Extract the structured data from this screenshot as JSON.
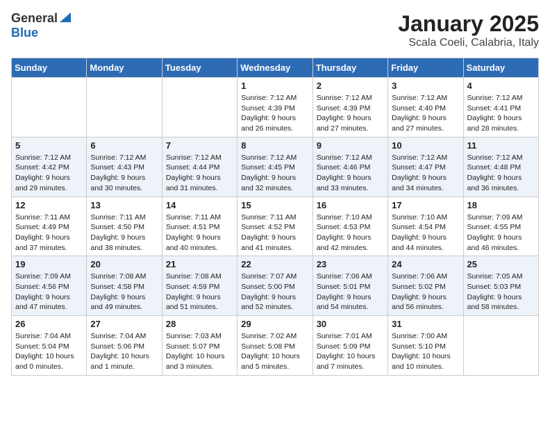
{
  "header": {
    "logo_general": "General",
    "logo_blue": "Blue",
    "month_year": "January 2025",
    "location": "Scala Coeli, Calabria, Italy"
  },
  "weekdays": [
    "Sunday",
    "Monday",
    "Tuesday",
    "Wednesday",
    "Thursday",
    "Friday",
    "Saturday"
  ],
  "weeks": [
    [
      {
        "day": "",
        "text": ""
      },
      {
        "day": "",
        "text": ""
      },
      {
        "day": "",
        "text": ""
      },
      {
        "day": "1",
        "text": "Sunrise: 7:12 AM\nSunset: 4:39 PM\nDaylight: 9 hours and 26 minutes."
      },
      {
        "day": "2",
        "text": "Sunrise: 7:12 AM\nSunset: 4:39 PM\nDaylight: 9 hours and 27 minutes."
      },
      {
        "day": "3",
        "text": "Sunrise: 7:12 AM\nSunset: 4:40 PM\nDaylight: 9 hours and 27 minutes."
      },
      {
        "day": "4",
        "text": "Sunrise: 7:12 AM\nSunset: 4:41 PM\nDaylight: 9 hours and 28 minutes."
      }
    ],
    [
      {
        "day": "5",
        "text": "Sunrise: 7:12 AM\nSunset: 4:42 PM\nDaylight: 9 hours and 29 minutes."
      },
      {
        "day": "6",
        "text": "Sunrise: 7:12 AM\nSunset: 4:43 PM\nDaylight: 9 hours and 30 minutes."
      },
      {
        "day": "7",
        "text": "Sunrise: 7:12 AM\nSunset: 4:44 PM\nDaylight: 9 hours and 31 minutes."
      },
      {
        "day": "8",
        "text": "Sunrise: 7:12 AM\nSunset: 4:45 PM\nDaylight: 9 hours and 32 minutes."
      },
      {
        "day": "9",
        "text": "Sunrise: 7:12 AM\nSunset: 4:46 PM\nDaylight: 9 hours and 33 minutes."
      },
      {
        "day": "10",
        "text": "Sunrise: 7:12 AM\nSunset: 4:47 PM\nDaylight: 9 hours and 34 minutes."
      },
      {
        "day": "11",
        "text": "Sunrise: 7:12 AM\nSunset: 4:48 PM\nDaylight: 9 hours and 36 minutes."
      }
    ],
    [
      {
        "day": "12",
        "text": "Sunrise: 7:11 AM\nSunset: 4:49 PM\nDaylight: 9 hours and 37 minutes."
      },
      {
        "day": "13",
        "text": "Sunrise: 7:11 AM\nSunset: 4:50 PM\nDaylight: 9 hours and 38 minutes."
      },
      {
        "day": "14",
        "text": "Sunrise: 7:11 AM\nSunset: 4:51 PM\nDaylight: 9 hours and 40 minutes."
      },
      {
        "day": "15",
        "text": "Sunrise: 7:11 AM\nSunset: 4:52 PM\nDaylight: 9 hours and 41 minutes."
      },
      {
        "day": "16",
        "text": "Sunrise: 7:10 AM\nSunset: 4:53 PM\nDaylight: 9 hours and 42 minutes."
      },
      {
        "day": "17",
        "text": "Sunrise: 7:10 AM\nSunset: 4:54 PM\nDaylight: 9 hours and 44 minutes."
      },
      {
        "day": "18",
        "text": "Sunrise: 7:09 AM\nSunset: 4:55 PM\nDaylight: 9 hours and 46 minutes."
      }
    ],
    [
      {
        "day": "19",
        "text": "Sunrise: 7:09 AM\nSunset: 4:56 PM\nDaylight: 9 hours and 47 minutes."
      },
      {
        "day": "20",
        "text": "Sunrise: 7:08 AM\nSunset: 4:58 PM\nDaylight: 9 hours and 49 minutes."
      },
      {
        "day": "21",
        "text": "Sunrise: 7:08 AM\nSunset: 4:59 PM\nDaylight: 9 hours and 51 minutes."
      },
      {
        "day": "22",
        "text": "Sunrise: 7:07 AM\nSunset: 5:00 PM\nDaylight: 9 hours and 52 minutes."
      },
      {
        "day": "23",
        "text": "Sunrise: 7:06 AM\nSunset: 5:01 PM\nDaylight: 9 hours and 54 minutes."
      },
      {
        "day": "24",
        "text": "Sunrise: 7:06 AM\nSunset: 5:02 PM\nDaylight: 9 hours and 56 minutes."
      },
      {
        "day": "25",
        "text": "Sunrise: 7:05 AM\nSunset: 5:03 PM\nDaylight: 9 hours and 58 minutes."
      }
    ],
    [
      {
        "day": "26",
        "text": "Sunrise: 7:04 AM\nSunset: 5:04 PM\nDaylight: 10 hours and 0 minutes."
      },
      {
        "day": "27",
        "text": "Sunrise: 7:04 AM\nSunset: 5:06 PM\nDaylight: 10 hours and 1 minute."
      },
      {
        "day": "28",
        "text": "Sunrise: 7:03 AM\nSunset: 5:07 PM\nDaylight: 10 hours and 3 minutes."
      },
      {
        "day": "29",
        "text": "Sunrise: 7:02 AM\nSunset: 5:08 PM\nDaylight: 10 hours and 5 minutes."
      },
      {
        "day": "30",
        "text": "Sunrise: 7:01 AM\nSunset: 5:09 PM\nDaylight: 10 hours and 7 minutes."
      },
      {
        "day": "31",
        "text": "Sunrise: 7:00 AM\nSunset: 5:10 PM\nDaylight: 10 hours and 10 minutes."
      },
      {
        "day": "",
        "text": ""
      }
    ]
  ]
}
